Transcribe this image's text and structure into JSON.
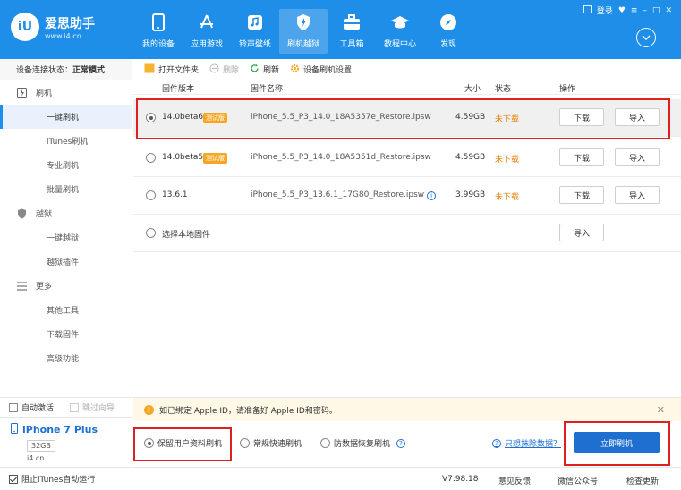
{
  "app": {
    "logo_mark": "iU",
    "title": "爱思助手",
    "url": "www.i4.cn"
  },
  "nav": [
    {
      "label": "我的设备",
      "icon": "phone-icon"
    },
    {
      "label": "应用游戏",
      "icon": "app-store-icon"
    },
    {
      "label": "铃声壁纸",
      "icon": "music-icon"
    },
    {
      "label": "刷机越狱",
      "icon": "flash-shield-icon"
    },
    {
      "label": "工具箱",
      "icon": "toolbox-icon"
    },
    {
      "label": "教程中心",
      "icon": "graduation-cap-icon"
    },
    {
      "label": "发现",
      "icon": "compass-icon"
    }
  ],
  "window": {
    "login": "登录"
  },
  "sidebar": {
    "conn_label": "设备连接状态：",
    "conn_value": "正常模式",
    "items": [
      {
        "label": "刷机",
        "type": "group",
        "icon": "flash-icon"
      },
      {
        "label": "一键刷机",
        "type": "sub",
        "active": true
      },
      {
        "label": "iTunes刷机",
        "type": "sub"
      },
      {
        "label": "专业刷机",
        "type": "sub"
      },
      {
        "label": "批量刷机",
        "type": "sub"
      },
      {
        "label": "越狱",
        "type": "group",
        "icon": "jailbreak-shield-icon"
      },
      {
        "label": "一键越狱",
        "type": "sub"
      },
      {
        "label": "越狱插件",
        "type": "sub"
      },
      {
        "label": "更多",
        "type": "group",
        "icon": "menu-icon"
      },
      {
        "label": "其他工具",
        "type": "sub"
      },
      {
        "label": "下载固件",
        "type": "sub"
      },
      {
        "label": "高级功能",
        "type": "sub"
      }
    ],
    "auto_activate": "自动激活",
    "skip_guide": "跳过向导",
    "device_name": "iPhone 7 Plus",
    "device_capacity": "32GB",
    "device_site": "i4.cn",
    "block_itunes": "阻止iTunes自动运行"
  },
  "toolbar": {
    "open_folder": "打开文件夹",
    "delete": "删除",
    "refresh": "刷新",
    "settings": "设备刷机设置"
  },
  "table": {
    "headers": {
      "version": "固件版本",
      "name": "固件名称",
      "size": "大小",
      "status": "状态",
      "action": "操作"
    },
    "rows": [
      {
        "version": "14.0beta6",
        "tag": "测试版",
        "name": "iPhone_5.5_P3_14.0_18A5357e_Restore.ipsw",
        "size": "4.59GB",
        "status": "未下载",
        "download": "下载",
        "import": "导入",
        "selected": true
      },
      {
        "version": "14.0beta5",
        "tag": "测试版",
        "name": "iPhone_5.5_P3_14.0_18A5351d_Restore.ipsw",
        "size": "4.59GB",
        "status": "未下载",
        "download": "下载",
        "import": "导入",
        "selected": false
      },
      {
        "version": "13.6.1",
        "tag": "",
        "name": "iPhone_5.5_P3_13.6.1_17G80_Restore.ipsw",
        "size": "3.99GB",
        "status": "未下载",
        "download": "下载",
        "import": "导入",
        "selected": false
      }
    ],
    "local_label": "选择本地固件",
    "local_import": "导入"
  },
  "bottom": {
    "warning": "如已绑定 Apple ID，请准备好 Apple ID和密码。",
    "opt_keep": "保留用户资料刷机",
    "opt_fast": "常规快速刷机",
    "opt_recover": "防数据恢复刷机",
    "help_link": "只想抹除数据？",
    "flash_button": "立即刷机"
  },
  "statusbar": {
    "version": "V7.98.18",
    "feedback": "意见反馈",
    "wechat": "微信公众号",
    "update": "检查更新"
  },
  "colors": {
    "brand": "#1e8ee8",
    "primary_button": "#1e6fd0",
    "status_orange": "#e8820c",
    "tag_orange": "#f5a623",
    "highlight_red": "#e02020"
  }
}
